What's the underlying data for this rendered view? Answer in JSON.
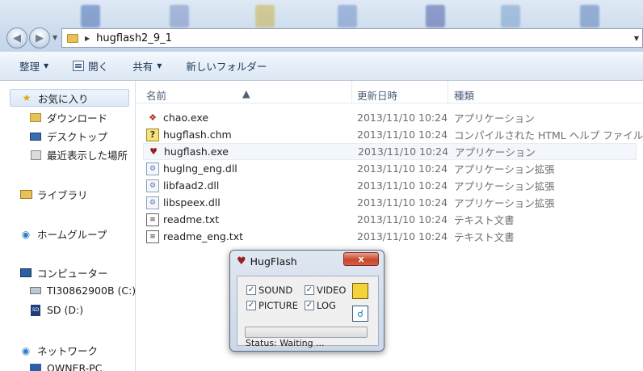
{
  "address": {
    "path": "hugflash2_9_1"
  },
  "toolbar": {
    "organize": "整理",
    "open": "開く",
    "share": "共有",
    "new_folder": "新しいフォルダー"
  },
  "nav": {
    "favorites": "お気に入り",
    "downloads": "ダウンロード",
    "desktop": "デスクトップ",
    "recent": "最近表示した場所",
    "libraries": "ライブラリ",
    "homegroup": "ホームグループ",
    "computer": "コンピューター",
    "drive_c": "TI30862900B (C:)",
    "drive_d": "SD (D:)",
    "network": "ネットワーク",
    "owner_pc": "OWNER-PC"
  },
  "columns": {
    "name": "名前",
    "date": "更新日時",
    "type": "種類"
  },
  "files": [
    {
      "name": "chao.exe",
      "date": "2013/11/10 10:24",
      "type": "アプリケーション",
      "icon": "chao-app-icon"
    },
    {
      "name": "hugflash.chm",
      "date": "2013/11/10 10:24",
      "type": "コンパイルされた HTML ヘルプ ファイル",
      "icon": "help-file-icon"
    },
    {
      "name": "hugflash.exe",
      "date": "2013/11/10 10:24",
      "type": "アプリケーション",
      "icon": "hugflash-app-icon"
    },
    {
      "name": "huglng_eng.dll",
      "date": "2013/11/10 10:24",
      "type": "アプリケーション拡張",
      "icon": "dll-file-icon"
    },
    {
      "name": "libfaad2.dll",
      "date": "2013/11/10 10:24",
      "type": "アプリケーション拡張",
      "icon": "dll-file-icon"
    },
    {
      "name": "libspeex.dll",
      "date": "2013/11/10 10:24",
      "type": "アプリケーション拡張",
      "icon": "dll-file-icon"
    },
    {
      "name": "readme.txt",
      "date": "2013/11/10 10:24",
      "type": "テキスト文書",
      "icon": "text-file-icon"
    },
    {
      "name": "readme_eng.txt",
      "date": "2013/11/10 10:24",
      "type": "テキスト文書",
      "icon": "text-file-icon"
    }
  ],
  "dialog": {
    "title": "HugFlash",
    "close": "x",
    "sound": "SOUND",
    "video": "VIDEO",
    "picture": "PICTURE",
    "log": "LOG",
    "status": "Status: Waiting ...",
    "progress": 0
  },
  "colors": {
    "accent": "#3fb02f",
    "close": "#c7452a",
    "selection": "#dde9f7"
  }
}
